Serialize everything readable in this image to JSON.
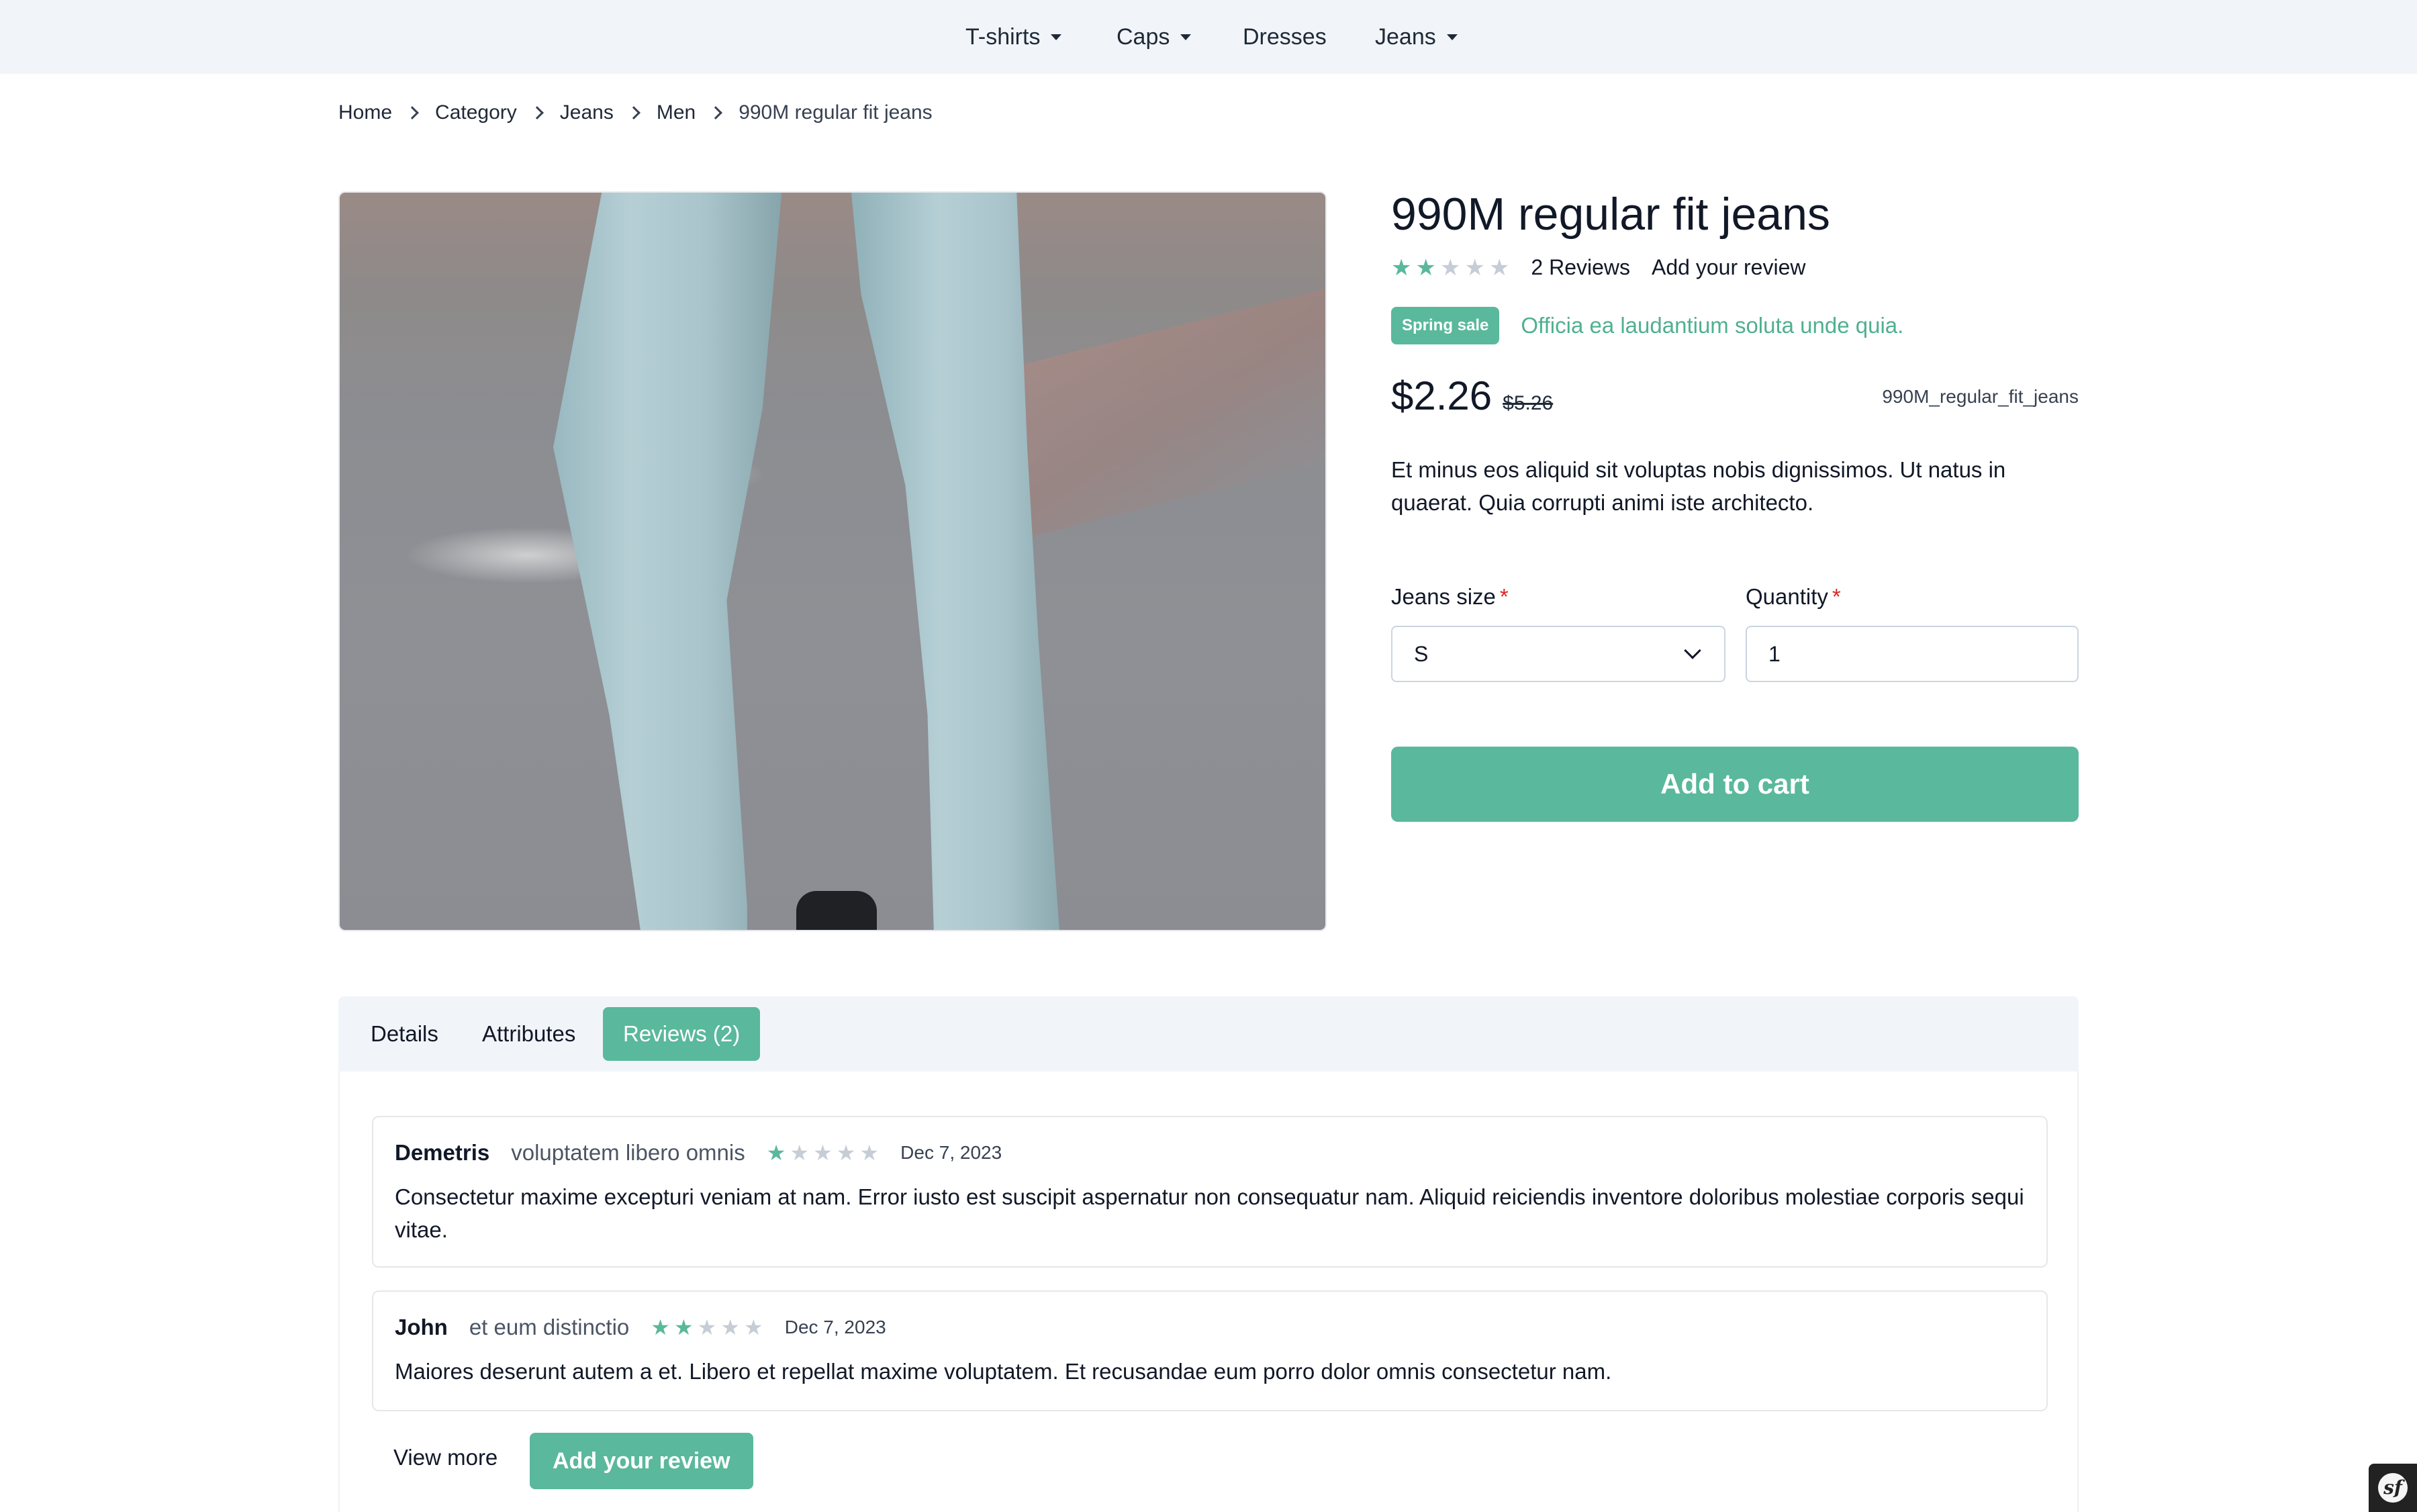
{
  "nav": {
    "items": [
      {
        "label": "T-shirts",
        "has_dropdown": true
      },
      {
        "label": "Caps",
        "has_dropdown": true
      },
      {
        "label": "Dresses",
        "has_dropdown": false
      },
      {
        "label": "Jeans",
        "has_dropdown": true
      }
    ]
  },
  "breadcrumb": [
    "Home",
    "Category",
    "Jeans",
    "Men",
    "990M regular fit jeans"
  ],
  "product": {
    "title": "990M regular fit jeans",
    "rating": 2,
    "rating_max": 5,
    "reviews_count_label": "2 Reviews",
    "add_review_link": "Add your review",
    "badge": "Spring sale",
    "promo_text": "Officia ea laudantium soluta unde quia.",
    "price": "$2.26",
    "old_price": "$5.26",
    "sku": "990M_regular_fit_jeans",
    "description": "Et minus eos aliquid sit voluptas nobis dignissimos. Ut natus in quaerat. Quia corrupti animi iste architecto.",
    "size_label": "Jeans size",
    "size_value": "S",
    "quantity_label": "Quantity",
    "quantity_value": "1",
    "required_mark": "*",
    "add_to_cart": "Add to cart"
  },
  "tabs": [
    {
      "label": "Details",
      "active": false
    },
    {
      "label": "Attributes",
      "active": false
    },
    {
      "label": "Reviews (2)",
      "active": true
    }
  ],
  "reviews": [
    {
      "author": "Demetris",
      "title": "voluptatem libero omnis",
      "rating": 1,
      "date": "Dec 7, 2023",
      "body": "Consectetur maxime excepturi veniam at nam. Error iusto est suscipit aspernatur non consequatur nam. Aliquid reiciendis inventore doloribus molestiae corporis sequi vitae."
    },
    {
      "author": "John",
      "title": "et eum distinctio",
      "rating": 2,
      "date": "Dec 7, 2023",
      "body": "Maiores deserunt autem a et. Libero et repellat maxime voluptatem. Et recusandae eum porro dolor omnis consectetur nam."
    }
  ],
  "reviews_actions": {
    "view_more": "View more",
    "add_review": "Add your review"
  },
  "colors": {
    "accent": "#5ab89c",
    "nav_bg": "#f1f5f9",
    "star_off": "#c7cdd6",
    "required": "#dc2626"
  },
  "icons": {
    "dropdown": "caret-down-icon",
    "breadcrumb_separator": "chevron-right-icon",
    "select": "chevron-down-icon",
    "star": "star-icon",
    "toolbar": "symfony-logo-icon"
  }
}
